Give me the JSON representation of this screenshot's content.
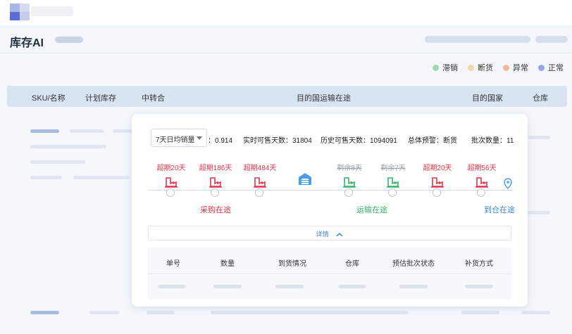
{
  "header": {
    "title": "库存AI"
  },
  "legend": [
    {
      "label": "滞销",
      "color": "#9fd7b3"
    },
    {
      "label": "断货",
      "color": "#f5d6a4"
    },
    {
      "label": "异常",
      "color": "#f3b79c"
    },
    {
      "label": "正常",
      "color": "#9aa4e6"
    }
  ],
  "table": {
    "columns": [
      "SKU/名称",
      "计划库存",
      "中转合",
      "目的国运输在途",
      "目的国家",
      "仓库"
    ]
  },
  "card": {
    "select": {
      "value": "7天日均销量"
    },
    "stats": {
      "avg_sales": "：0.914",
      "realtime_days": "实时可售天数：31804",
      "history_days": "历史可售天数：1094091",
      "overall_alert": "总体预警：断货",
      "batch_count": "批次数量：11"
    },
    "timeline": [
      {
        "label": "超期20天",
        "tone": "red",
        "icon": "factory-icon"
      },
      {
        "label": "超期186天",
        "tone": "red",
        "icon": "factory-icon"
      },
      {
        "label": "超期484天",
        "tone": "red",
        "icon": "factory-icon"
      },
      {
        "label": "",
        "tone": "blue",
        "icon": "warehouse-icon"
      },
      {
        "label": "剩余8天",
        "tone": "gray",
        "icon": "factory-icon"
      },
      {
        "label": "剩余7天",
        "tone": "gray",
        "icon": "factory-icon"
      },
      {
        "label": "超期20天",
        "tone": "red",
        "icon": "factory-icon"
      },
      {
        "label": "超期56天",
        "tone": "red",
        "icon": "factory-icon"
      }
    ],
    "phases": {
      "purchasing": "采购在途",
      "shipping": "运输在途",
      "to_warehouse": "到仓在途"
    },
    "details_label": "详情",
    "subtable_columns": [
      "单号",
      "数量",
      "到货情况",
      "仓库",
      "预估批次状态",
      "补货方式"
    ]
  }
}
